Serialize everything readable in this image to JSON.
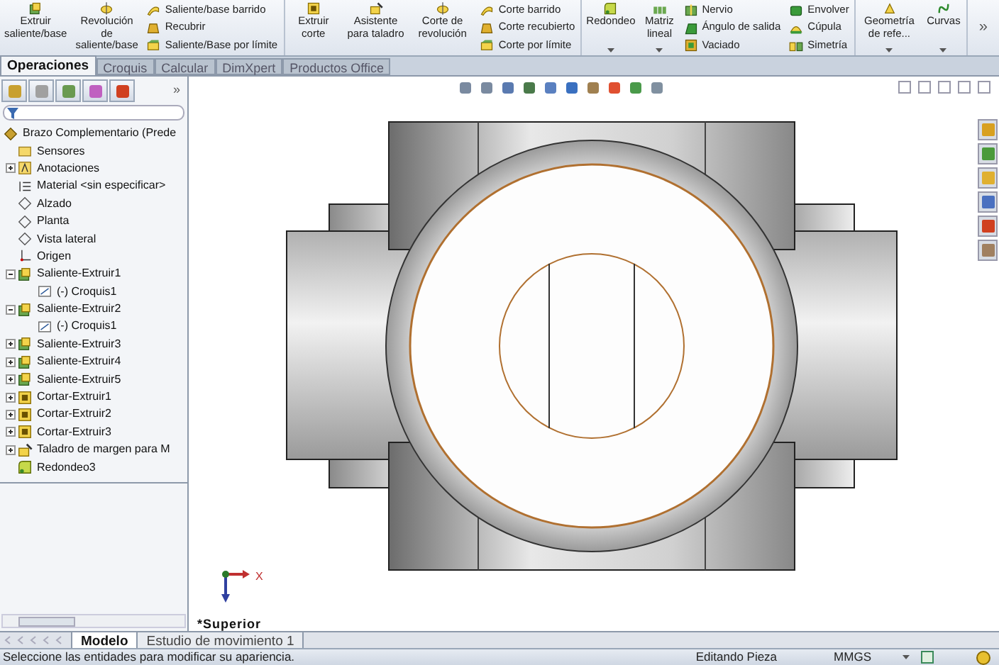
{
  "ribbon": {
    "groups": [
      {
        "items": [
          {
            "kind": "large",
            "label": "Extruir saliente/base",
            "dropdown": false
          },
          {
            "kind": "large",
            "label": "Revolución de saliente/base",
            "dropdown": false
          },
          {
            "kind": "stack",
            "entries": [
              {
                "label": "Saliente/base barrido"
              },
              {
                "label": "Recubrir"
              },
              {
                "label": "Saliente/Base por límite"
              }
            ]
          }
        ]
      },
      {
        "items": [
          {
            "kind": "large",
            "label": "Extruir corte",
            "dropdown": false
          },
          {
            "kind": "large",
            "label": "Asistente para taladro",
            "dropdown": false
          },
          {
            "kind": "large",
            "label": "Corte de revolución",
            "dropdown": false
          },
          {
            "kind": "stack",
            "entries": [
              {
                "label": "Corte barrido"
              },
              {
                "label": "Corte recubierto"
              },
              {
                "label": "Corte por límite"
              }
            ]
          }
        ]
      },
      {
        "items": [
          {
            "kind": "large",
            "label": "Redondeo",
            "dropdown": true
          },
          {
            "kind": "large",
            "label": "Matriz lineal",
            "dropdown": true
          },
          {
            "kind": "stack",
            "entries": [
              {
                "label": "Nervio"
              },
              {
                "label": "Ángulo de salida"
              },
              {
                "label": "Vaciado"
              }
            ]
          },
          {
            "kind": "stack",
            "entries": [
              {
                "label": "Envolver"
              },
              {
                "label": "Cúpula"
              },
              {
                "label": "Simetría"
              }
            ]
          }
        ]
      },
      {
        "items": [
          {
            "kind": "large",
            "label": "Geometría de refe...",
            "dropdown": true
          },
          {
            "kind": "large",
            "label": "Curvas",
            "dropdown": true
          }
        ]
      }
    ],
    "overflow": "»"
  },
  "tabs": [
    {
      "label": "Operaciones",
      "selected": true
    },
    {
      "label": "Croquis",
      "selected": false
    },
    {
      "label": "Calcular",
      "selected": false
    },
    {
      "label": "DimXpert",
      "selected": false
    },
    {
      "label": "Productos Office",
      "selected": false
    }
  ],
  "feature_manager": {
    "overflow": "»",
    "tree": {
      "label": "Brazo Complementario  (Prede",
      "kind": "part",
      "children": [
        {
          "label": "Sensores",
          "kind": "sensors"
        },
        {
          "label": "Anotaciones",
          "kind": "annotations",
          "expanded": false
        },
        {
          "label": "Material <sin especificar>",
          "kind": "material"
        },
        {
          "label": "Alzado",
          "kind": "plane"
        },
        {
          "label": "Planta",
          "kind": "plane"
        },
        {
          "label": "Vista lateral",
          "kind": "plane"
        },
        {
          "label": "Origen",
          "kind": "origin"
        },
        {
          "label": "Saliente-Extruir1",
          "kind": "extrude",
          "expanded": true,
          "children": [
            {
              "label": "(-) Croquis1",
              "kind": "sketch"
            }
          ]
        },
        {
          "label": "Saliente-Extruir2",
          "kind": "extrude",
          "expanded": true,
          "children": [
            {
              "label": "(-) Croquis1",
              "kind": "sketch"
            }
          ]
        },
        {
          "label": "Saliente-Extruir3",
          "kind": "extrude",
          "expanded": false
        },
        {
          "label": "Saliente-Extruir4",
          "kind": "extrude",
          "expanded": false
        },
        {
          "label": "Saliente-Extruir5",
          "kind": "extrude",
          "expanded": false
        },
        {
          "label": "Cortar-Extruir1",
          "kind": "cut",
          "expanded": false
        },
        {
          "label": "Cortar-Extruir2",
          "kind": "cut",
          "expanded": false
        },
        {
          "label": "Cortar-Extruir3",
          "kind": "cut",
          "expanded": false
        },
        {
          "label": "Taladro de margen para M",
          "kind": "hole",
          "expanded": false
        },
        {
          "label": "Redondeo3",
          "kind": "fillet"
        }
      ]
    }
  },
  "viewport": {
    "view_label": "*Superior",
    "axis_label": "X"
  },
  "bottom_tabs": [
    {
      "label": "Modelo",
      "selected": true
    },
    {
      "label": "Estudio de movimiento 1",
      "selected": false
    }
  ],
  "status_bar": {
    "message": "Seleccione las entidades para modificar su apariencia.",
    "mode": "Editando Pieza",
    "units": "MMGS"
  }
}
